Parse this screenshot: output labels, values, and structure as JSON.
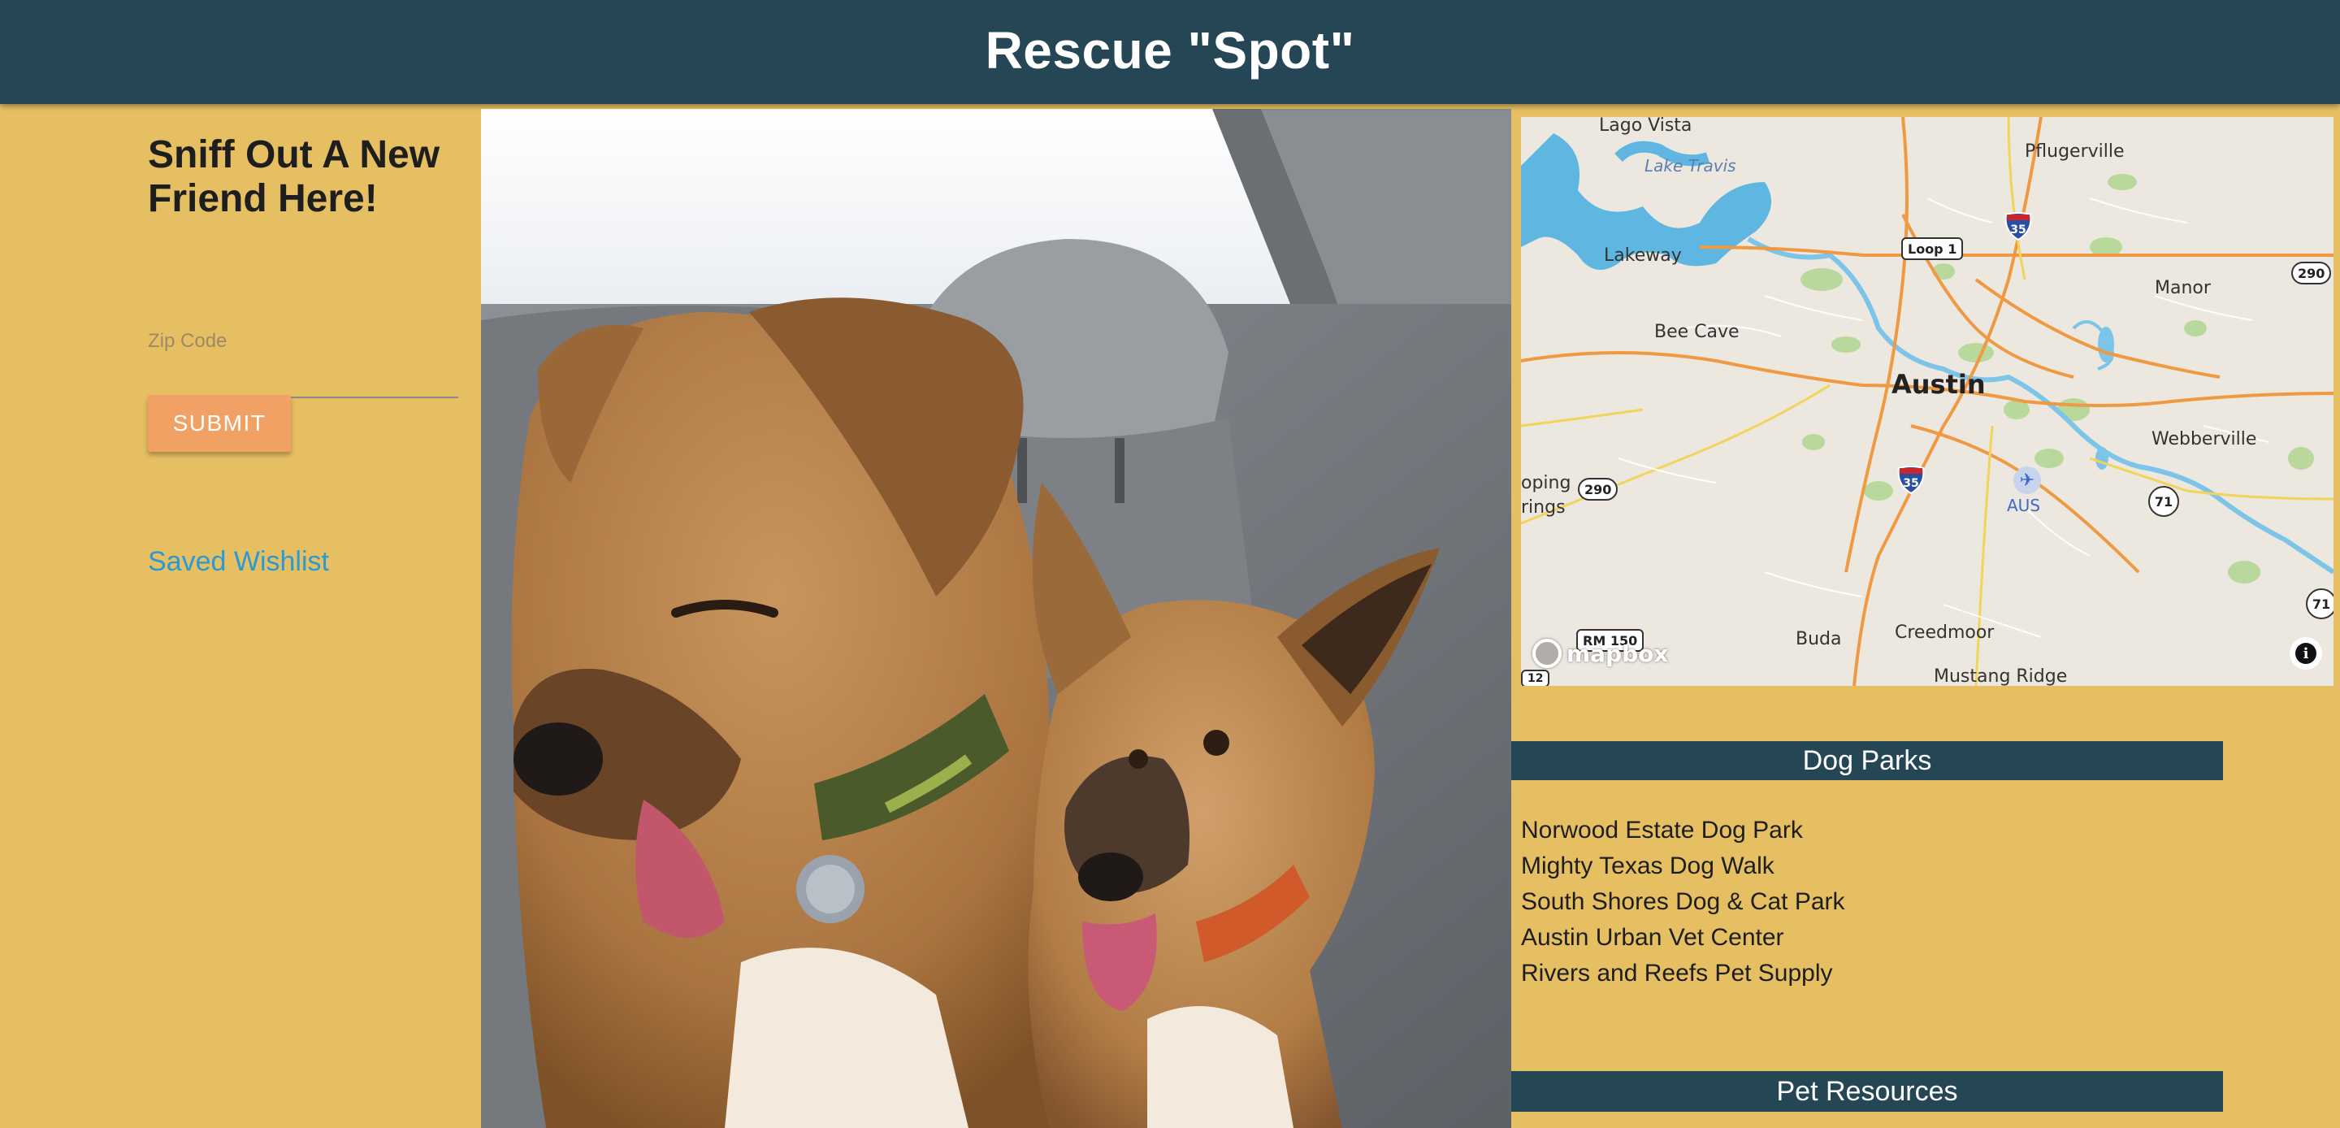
{
  "header": {
    "title": "Rescue \"Spot\""
  },
  "search": {
    "tagline": "Sniff Out A New Friend Here!",
    "zip_label": "Zip Code",
    "zip_value": "",
    "submit_label": "SUBMIT"
  },
  "wishlist": {
    "label": "Saved Wishlist"
  },
  "photo": {
    "subject": "two tan dogs in car back seat"
  },
  "map": {
    "labels": {
      "lago_vista": "Lago Vista",
      "lake_travis": "Lake Travis",
      "pflugerville": "Pflugerville",
      "lakeway": "Lakeway",
      "manor": "Manor",
      "bee_cave": "Bee Cave",
      "austin": "Austin",
      "webberville": "Webberville",
      "dripping_springs_1": "oping",
      "dripping_springs_2": "rings",
      "aus": "AUS",
      "buda": "Buda",
      "creedmoor": "Creedmoor",
      "mustang_ridge": "Mustang Ridge"
    },
    "shields": {
      "loop1": "Loop 1",
      "i35_north": "35",
      "i35_south": "35",
      "us290_east": "290",
      "us290_west": "290",
      "sh71_a": "71",
      "sh71_b": "71",
      "rm150": "RM 150",
      "rm12": "12"
    },
    "attribution": "mapbox",
    "info_symbol": "i"
  },
  "dog_parks": {
    "heading": "Dog Parks",
    "items": [
      "Norwood Estate Dog Park",
      "Mighty Texas Dog Walk",
      "South Shores Dog & Cat Park",
      "Austin Urban Vet Center",
      "Rivers and Reefs Pet Supply"
    ]
  },
  "pet_resources": {
    "heading": "Pet Resources"
  },
  "colors": {
    "background": "#e6bf62",
    "header": "#254654",
    "button": "#f2a164",
    "link": "#2a9ad4"
  }
}
